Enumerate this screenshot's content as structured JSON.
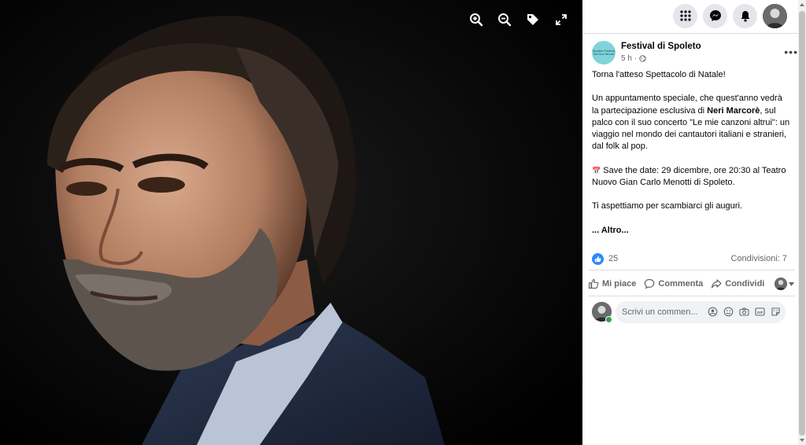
{
  "viewer": {
    "tools": [
      "zoom-in-icon",
      "zoom-out-icon",
      "tag-icon",
      "fullscreen-icon"
    ]
  },
  "topbar": {
    "icons": [
      "menu-grid-icon",
      "messenger-icon",
      "notifications-icon",
      "profile-avatar"
    ]
  },
  "post": {
    "page_name": "Festival di Spoleto",
    "avatar_text": "Spoleto Festival dei Due Mondi",
    "time": "5 h",
    "audience_icon": "globe-icon",
    "more": "•••",
    "paragraph1": "Torna l'atteso Spettacolo di Natale!",
    "paragraph2_pre": "Un appuntamento speciale, che quest'anno vedrà la partecipazione esclusiva di ",
    "paragraph2_bold": "Neri Marcorè",
    "paragraph2_post": ", sul palco con il suo concerto \"Le mie canzoni altrui\": un viaggio nel mondo dei cantautori italiani e stranieri, dal folk al pop.",
    "paragraph3_icon": "📅",
    "paragraph3": " Save the date: 29 dicembre, ore 20:30 al Teatro Nuovo Gian Carlo Menotti di Spoleto.",
    "paragraph4": "Ti aspettiamo per scambiarci gli auguri.",
    "more_link": "... Altro..."
  },
  "reactions": {
    "count": "25",
    "shares": "Condivisioni: 7"
  },
  "actions": {
    "like": "Mi piace",
    "comment": "Commenta",
    "share": "Condividi"
  },
  "comment": {
    "placeholder": "Scrivi un commento...",
    "placeholder_visible": "Scrivi un commen...",
    "icons": [
      "avatar-sticker-icon",
      "emoji-icon",
      "camera-icon",
      "gif-icon",
      "sticker-icon"
    ]
  },
  "colors": {
    "accent": "#2d88ff",
    "muted": "#65676b",
    "viewer_bg": "#000000",
    "chip_bg": "#e4e6eb"
  }
}
